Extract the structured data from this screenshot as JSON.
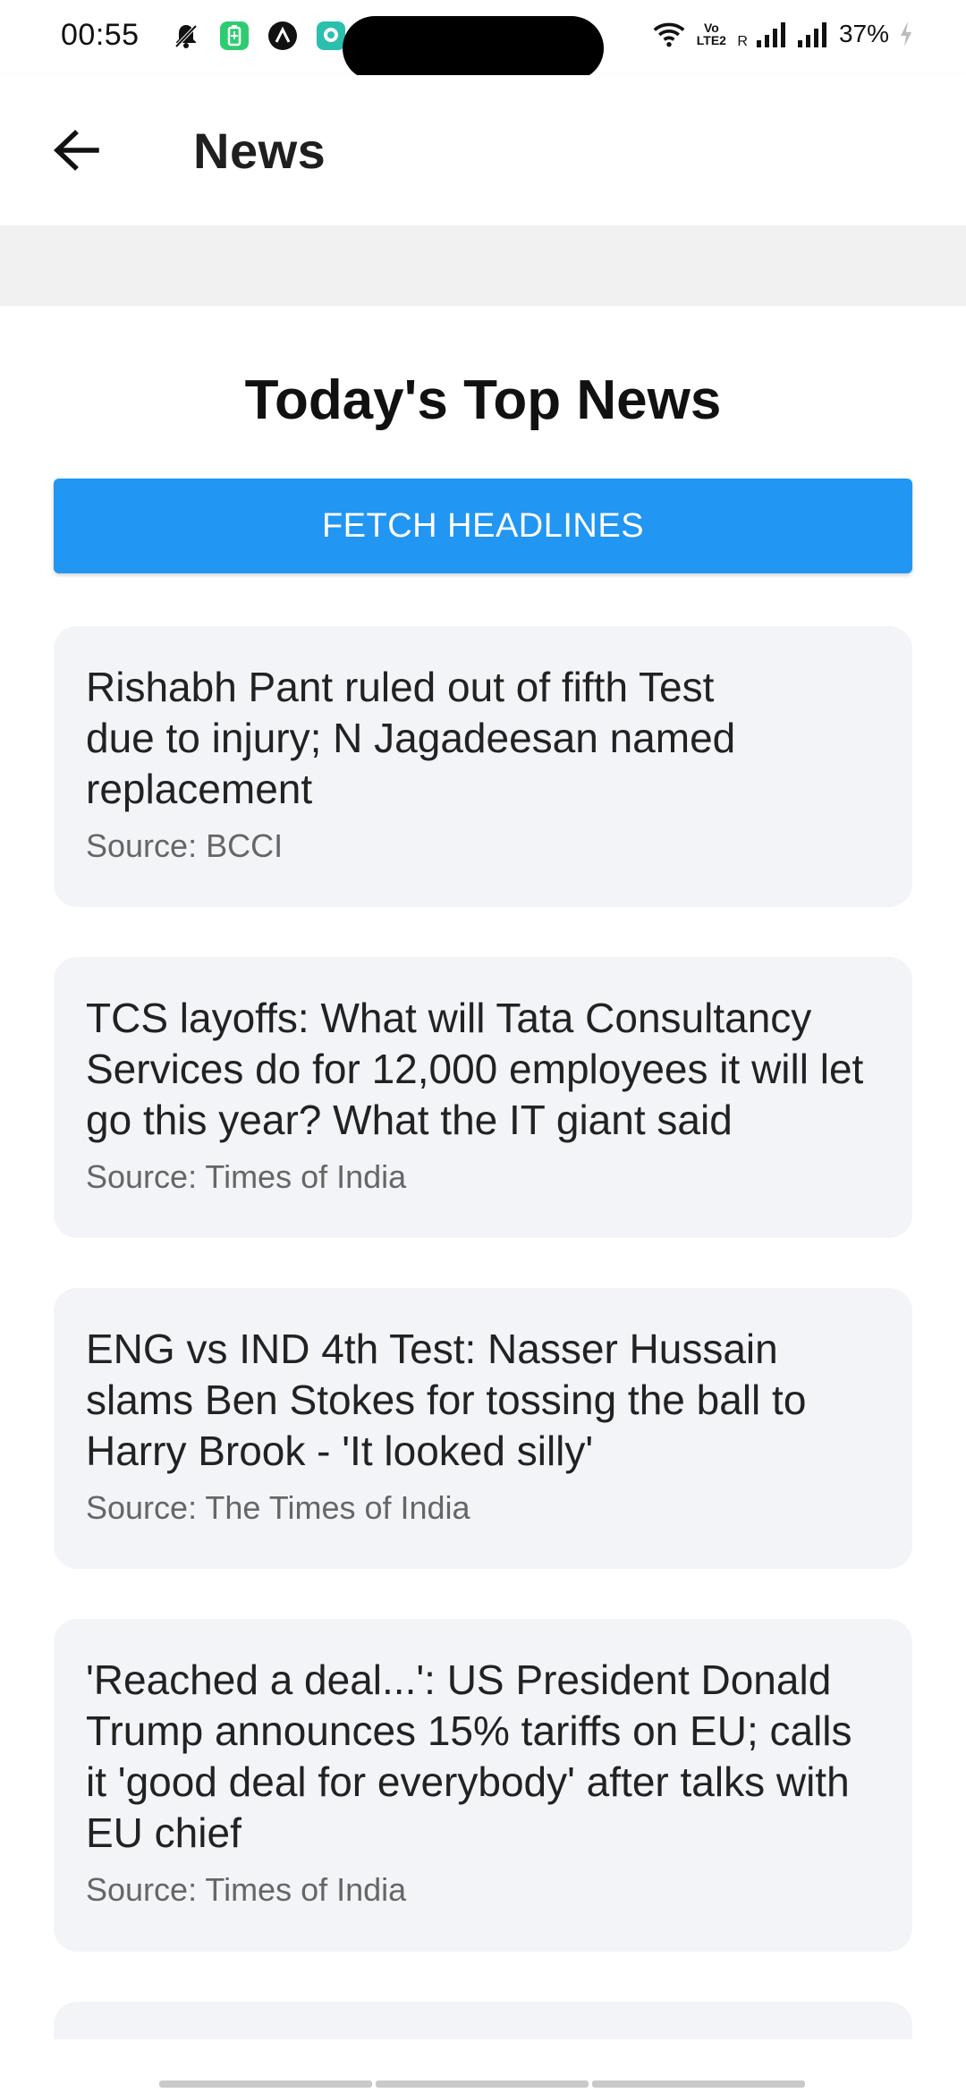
{
  "status_bar": {
    "time": "00:55",
    "battery_percent": "37%",
    "icons": [
      "mute-bell-icon",
      "battery-saver-icon",
      "app-icon",
      "chat-icon",
      "wifi-icon",
      "volte-icon",
      "signal-icon",
      "signal-icon",
      "charging-icon"
    ],
    "volte_label": "Vo LTE2",
    "roaming_label": "R"
  },
  "app_bar": {
    "back_icon": "arrow-left-icon",
    "title": "News"
  },
  "main": {
    "heading": "Today's Top News",
    "fetch_button_label": "FETCH HEADLINES",
    "accent_color": "#2196f3",
    "articles": [
      {
        "title": "Rishabh Pant ruled out of fifth Test due to injury; N Jagadeesan named replacement",
        "source": "Source: BCCI"
      },
      {
        "title": "TCS layoffs: What will Tata Consultancy Services do for 12,000 employees it will let go this year? What the IT giant said",
        "source": "Source: Times of India"
      },
      {
        "title": "ENG vs IND 4th Test: Nasser Hussain slams Ben Stokes for tossing the ball to Harry Brook - 'It looked silly'",
        "source": "Source: The Times of India"
      },
      {
        "title": "'Reached a deal...': US President Donald Trump announces 15% tariffs on EU; calls it 'good deal for everybody' after talks with EU chief",
        "source": "Source: Times of India"
      }
    ]
  }
}
